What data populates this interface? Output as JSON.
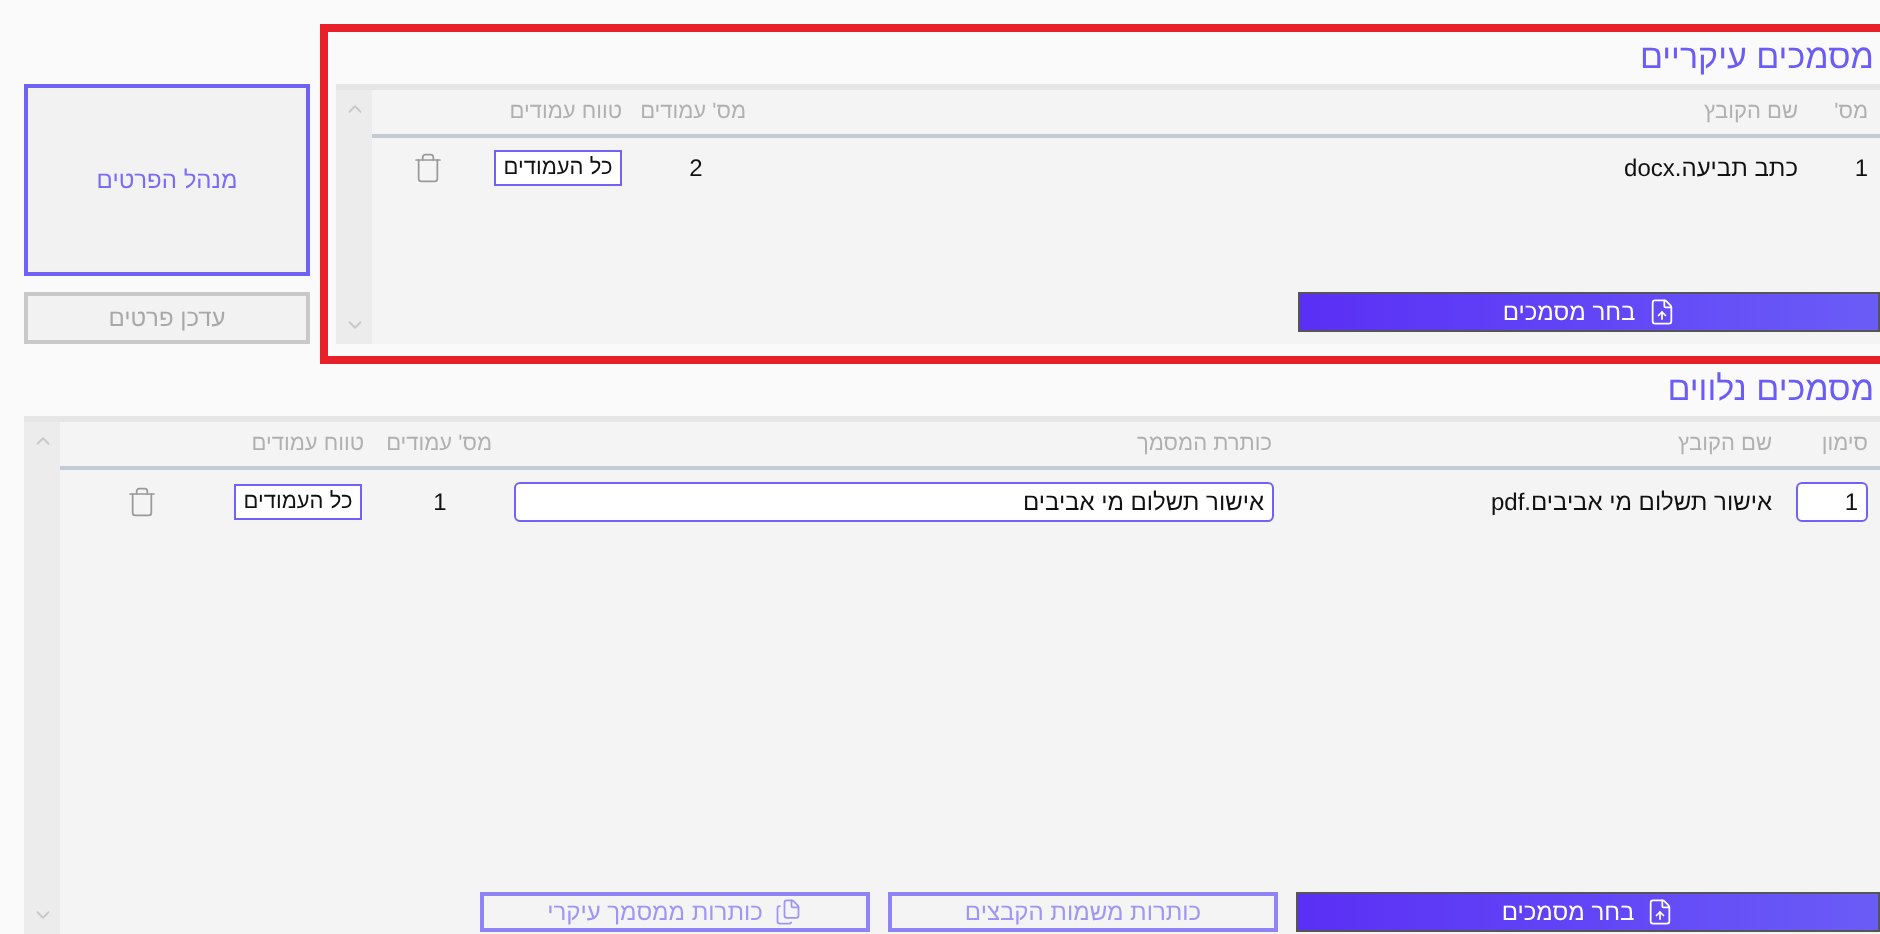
{
  "side_panel": {
    "manager_button": {
      "label": "מנהל הפרטים"
    },
    "update_button": {
      "label": "עדכן פרטים",
      "disabled": true
    }
  },
  "main_documents": {
    "title": "מסמכים עיקריים",
    "highlighted": true,
    "columns": [
      "מס'",
      "שם הקובץ",
      "מס' עמודים",
      "טווח עמודים"
    ],
    "rows": [
      {
        "number": "1",
        "file_name": "כתב תביעה.docx",
        "pages": "2",
        "page_range": "כל העמודים"
      }
    ],
    "choose_button": {
      "label": "בחר מסמכים"
    }
  },
  "attached_documents": {
    "title": "מסמכים נלווים",
    "columns": [
      "סימון",
      "שם הקובץ",
      "כותרת המסמך",
      "מס' עמודים",
      "טווח עמודים"
    ],
    "rows": [
      {
        "mark": "1",
        "file_name": "אישור תשלום מי אביבים.pdf",
        "document_title": "אישור תשלום מי אביבים",
        "pages": "1",
        "page_range": "כל העמודים"
      }
    ],
    "buttons": [
      {
        "kind": "primary",
        "label": "בחר מסמכים"
      },
      {
        "kind": "outline",
        "label": "כותרות משמות הקבצים"
      },
      {
        "kind": "outline-icon",
        "label": "כותרות ממסמך עיקרי"
      }
    ]
  }
}
